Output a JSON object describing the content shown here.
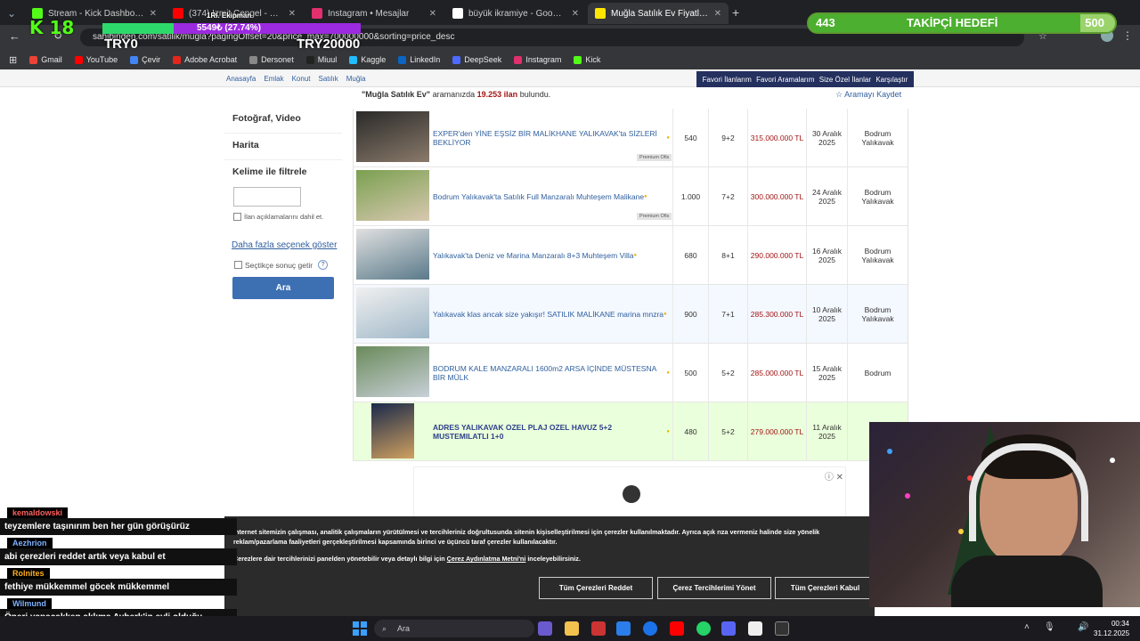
{
  "browser": {
    "tabs": [
      {
        "label": "Stream - Kick Dashboard",
        "color": "#53fc18",
        "active": false
      },
      {
        "label": "(374) İzmit Çengel - Made in Ru",
        "color": "#ff0000",
        "active": false
      },
      {
        "label": "Instagram • Mesajlar",
        "color": "#e1306c",
        "active": false
      },
      {
        "label": "büyük ikramiye - Google'da Ara",
        "color": "#ffffff",
        "active": false
      },
      {
        "label": "Muğla Satılık Ev Fiyatları sahibi",
        "color": "#ffe600",
        "active": true
      }
    ],
    "url": "sahibinden.com/satilik/mugla?pagingOffset=20&price_max=700000000&sorting=price_desc",
    "bookmarks": [
      {
        "label": "Gmail",
        "color": "#ea4335"
      },
      {
        "label": "YouTube",
        "color": "#ff0000"
      },
      {
        "label": "Çevir",
        "color": "#4285f4"
      },
      {
        "label": "Adobe Acrobat",
        "color": "#e3261c"
      },
      {
        "label": "Dersonet",
        "color": "#888888"
      },
      {
        "label": "Miuul",
        "color": "#222222"
      },
      {
        "label": "Kaggle",
        "color": "#20beff"
      },
      {
        "label": "LinkedIn",
        "color": "#0a66c2"
      },
      {
        "label": "DeepSeek",
        "color": "#4d6bfe"
      },
      {
        "label": "Instagram",
        "color": "#e1306c"
      },
      {
        "label": "Kick",
        "color": "#53fc18"
      }
    ]
  },
  "site": {
    "breadcrumb": [
      "Anasayfa",
      "Emlak",
      "Konut",
      "Satılık",
      "Muğla"
    ],
    "topnav": [
      "Favori İlanlarım",
      "Favori Aramalarım",
      "Size Özel İlanlar",
      "Karşılaştır"
    ],
    "results_prefix": "\"Muğla Satılık Ev\"",
    "results_mid": "aramanızda",
    "results_count": "19.253 ilan",
    "results_suffix": "bulundu.",
    "save_search": "Aramayı Kaydet",
    "sidebar": {
      "photo_video": "Fotoğraf, Video",
      "map": "Harita",
      "keyword_filter": "Kelime ile filtrele",
      "include_desc": "İlan açıklamalarını dahil et.",
      "more_options": "Daha fazla seçenek göster",
      "choose_results": "Seçtikçe sonuç getir",
      "help": "?",
      "search_button": "Ara"
    },
    "listings": [
      {
        "title": "EXPER'den YİNE EŞSİZ BİR MALİKHANE YALIKAVAK'ta SİZLERİ BEKLİYOR",
        "m2": "540",
        "rooms": "9+2",
        "price": "315.000.000 TL",
        "date": "30 Aralık 2025",
        "location": "Bodrum Yalıkavak",
        "badge": "Premium Ofis",
        "highlight": false
      },
      {
        "title": "Bodrum Yalıkavak'ta Satılık Full Manzaralı Muhteşem Malikane",
        "m2": "1.000",
        "rooms": "7+2",
        "price": "300.000.000 TL",
        "date": "24 Aralık 2025",
        "location": "Bodrum Yalıkavak",
        "badge": "Premium Ofis",
        "highlight": false
      },
      {
        "title": "Yalıkavak'ta Deniz ve Marina Manzaralı 8+3 Muhteşem Villa",
        "m2": "680",
        "rooms": "8+1",
        "price": "290.000.000 TL",
        "date": "16 Aralık 2025",
        "location": "Bodrum Yalıkavak",
        "badge": "",
        "highlight": false
      },
      {
        "title": "Yalıkavak klas ancak size yakışır! SATILIK MALİKANE marina mnzra",
        "m2": "900",
        "rooms": "7+1",
        "price": "285.300.000 TL",
        "date": "10 Aralık 2025",
        "location": "Bodrum Yalıkavak",
        "badge": "",
        "highlight": false
      },
      {
        "title": "BODRUM KALE MANZARALI 1600m2 ARSA İÇİNDE MÜSTESNA BİR MÜLK",
        "m2": "500",
        "rooms": "5+2",
        "price": "285.000.000 TL",
        "date": "15 Aralık 2025",
        "location": "Bodrum",
        "badge": "",
        "highlight": false
      },
      {
        "title": "ADRES YALIKAVAK OZEL PLAJ OZEL HAVUZ 5+2 MUSTEMILATLI 1+0",
        "m2": "480",
        "rooms": "5+2",
        "price": "279.000.000 TL",
        "date": "11 Aralık 2025",
        "location": "B",
        "badge": "",
        "highlight": true
      }
    ],
    "cookie": {
      "text1": "İnternet sitemizin çalışması, analitik çalışmaların yürütülmesi ve tercihleriniz doğrultusunda sitenin kişiselleştirilmesi için çerezler kullanılmaktadır. Ayrıca açık rıza vermeniz halinde size yönelik reklam/pazarlama faaliyetleri gerçekleştirilmesi kapsamında birinci ve üçüncü taraf çerezler kullanılacaktır.",
      "text2_prefix": "Çerezlere dair tercihlerinizi panelden yönetebilir veya detaylı bilgi için",
      "text2_link": "Çerez Aydınlatma Metni'ni",
      "text2_suffix": "inceleyebilirsiniz.",
      "reject": "Tüm Çerezleri Reddet",
      "prefs": "Çerez Tercihlerimi Yönet",
      "accept": "Tüm Çerezleri Kabul"
    }
  },
  "overlay": {
    "kick_level": "18",
    "progress_label": "1Rl. Ekipman",
    "progress_text": "5549₺ (27.74%)",
    "progress_fraction": 0.2774,
    "try_left": "TRY0",
    "try_right": "TRY20000",
    "follower_current": "443",
    "follower_label": "TAKİPÇİ HEDEFİ",
    "follower_goal": "500",
    "follower_fraction": 0.886,
    "chat": [
      {
        "user": "kemaldowski",
        "msg": "teyzemlere taşınırım ben her gün görüşürüz",
        "color": "red"
      },
      {
        "user": "Aezhrion",
        "msg": "abi çerezleri reddet artık veya kabul et",
        "color": "blue"
      },
      {
        "user": "Rolnites",
        "msg": "fethiye mükkemmel göcek mükkemmel",
        "color": "orange"
      },
      {
        "user": "Wilmund",
        "msg": "Öneri yapacakken aklıma Ayberk'in evli olduğu geliyor",
        "color": "blue"
      }
    ]
  },
  "taskbar": {
    "search_placeholder": "Ara",
    "time": "00:34",
    "date": "31.12.2025"
  }
}
